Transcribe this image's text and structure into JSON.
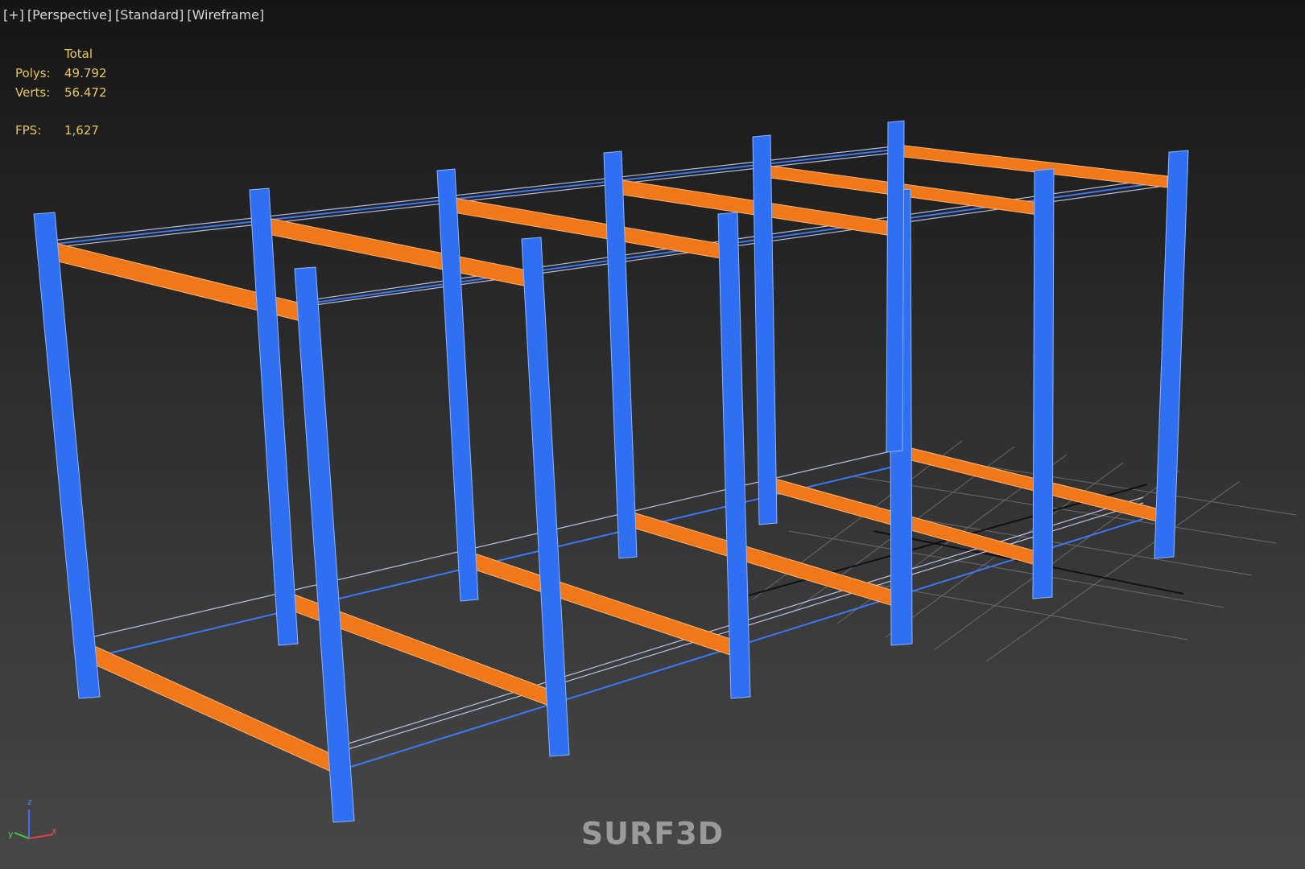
{
  "viewport": {
    "labels": [
      "[+]",
      "[Perspective]",
      "[Standard]",
      "[Wireframe]"
    ],
    "stats": {
      "header": "Total",
      "polys_label": "Polys:",
      "polys_value": "49.792",
      "verts_label": "Verts:",
      "verts_value": "56.472",
      "fps_label": "FPS:",
      "fps_value": "1,627"
    },
    "axis_gizmo": {
      "z": "z",
      "y": "y",
      "x": "x"
    },
    "watermark": "SURF3D"
  },
  "colors": {
    "uprights": "#2f6ff2",
    "beams": "#f07818",
    "grid": "#8a8a8a",
    "stats_text": "#e6c85a",
    "label_text": "#d8d8d8"
  }
}
